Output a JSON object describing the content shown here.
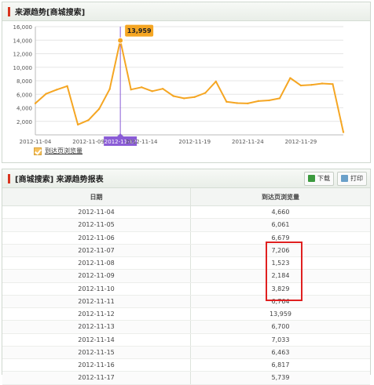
{
  "trend_panel": {
    "title": "来源趋势[商城搜索]"
  },
  "report_panel": {
    "title": "[商城搜索] 来源趋势报表",
    "download_label": "下载",
    "print_label": "打印",
    "columns": [
      "日期",
      "到达页浏览量"
    ],
    "rows": [
      [
        "2012-11-04",
        "4,660"
      ],
      [
        "2012-11-05",
        "6,061"
      ],
      [
        "2012-11-06",
        "6,679"
      ],
      [
        "2012-11-07",
        "7,206"
      ],
      [
        "2012-11-08",
        "1,523"
      ],
      [
        "2012-11-09",
        "2,184"
      ],
      [
        "2012-11-10",
        "3,829"
      ],
      [
        "2012-11-11",
        "6,764"
      ],
      [
        "2012-11-12",
        "13,959"
      ],
      [
        "2012-11-13",
        "6,700"
      ],
      [
        "2012-11-14",
        "7,033"
      ],
      [
        "2012-11-15",
        "6,463"
      ],
      [
        "2012-11-16",
        "6,817"
      ],
      [
        "2012-11-17",
        "5,739"
      ]
    ],
    "highlighted_rows": [
      "2012-11-07",
      "2012-11-08",
      "2012-11-09",
      "2012-11-10",
      "2012-11-11"
    ]
  },
  "colors": {
    "line": "#f5a623",
    "highlight": "#8a5cd6",
    "tooltip": "#f5a623",
    "alert_box": "#e02020"
  },
  "chart_data": {
    "type": "line",
    "title": "",
    "xlabel": "",
    "ylabel": "",
    "ylim": [
      0,
      16000
    ],
    "y_ticks": [
      "2,000",
      "4,000",
      "6,000",
      "8,000",
      "10,000",
      "12,000",
      "14,000",
      "16,000"
    ],
    "x": [
      "2012-11-04",
      "2012-11-05",
      "2012-11-06",
      "2012-11-07",
      "2012-11-08",
      "2012-11-09",
      "2012-11-10",
      "2012-11-11",
      "2012-11-12",
      "2012-11-13",
      "2012-11-14",
      "2012-11-15",
      "2012-11-16",
      "2012-11-17",
      "2012-11-18",
      "2012-11-19",
      "2012-11-20",
      "2012-11-21",
      "2012-11-22",
      "2012-11-23",
      "2012-11-24",
      "2012-11-25",
      "2012-11-26",
      "2012-11-27",
      "2012-11-28",
      "2012-11-29",
      "2012-11-30",
      "2012-12-01",
      "2012-12-02",
      "2012-12-03"
    ],
    "x_tick_labels": [
      "2012-11-04",
      "2012-11-09",
      "2012-11-12",
      "2012-11-14",
      "2012-11-19",
      "2012-11-24",
      "2012-11-29"
    ],
    "series": [
      {
        "name": "到达页浏览量",
        "values": [
          4660,
          6061,
          6679,
          7206,
          1523,
          2184,
          3829,
          6764,
          13959,
          6700,
          7033,
          6463,
          6817,
          5739,
          5400,
          5600,
          6200,
          7900,
          4900,
          4700,
          4650,
          5000,
          5100,
          5400,
          8400,
          7300,
          7400,
          7600,
          7500,
          400
        ]
      }
    ],
    "highlight": {
      "x": "2012-11-12",
      "label": "13,959"
    },
    "grid": true,
    "legend": "bottom-left"
  }
}
